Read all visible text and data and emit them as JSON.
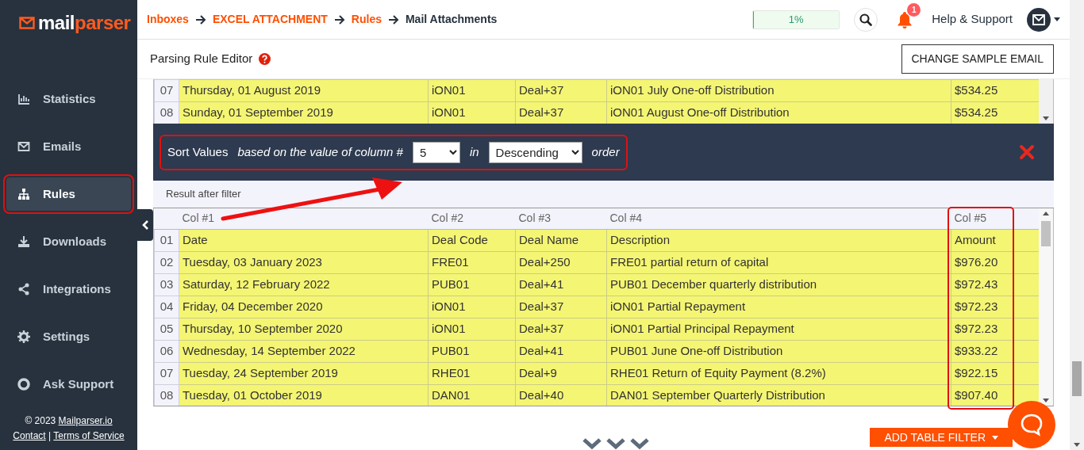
{
  "logo": {
    "text": "mail",
    "accent": "parser"
  },
  "sidebar": {
    "items": [
      {
        "label": "Statistics",
        "selected": false
      },
      {
        "label": "Emails",
        "selected": false
      },
      {
        "label": "Rules",
        "selected": true
      },
      {
        "label": "Downloads",
        "selected": false
      },
      {
        "label": "Integrations",
        "selected": false
      },
      {
        "label": "Settings",
        "selected": false
      },
      {
        "label": "Ask Support",
        "selected": false
      }
    ],
    "footer": {
      "copyright": "© 2023",
      "site_link": "Mailparser.io",
      "links": [
        "Contact",
        "Terms of Service"
      ],
      "separator": "|"
    }
  },
  "breadcrumb": [
    {
      "label": "Inboxes",
      "current": false
    },
    {
      "label": "EXCEL ATTACHMENT",
      "current": false
    },
    {
      "label": "Rules",
      "current": false
    },
    {
      "label": "Mail Attachments",
      "current": true
    }
  ],
  "usage": {
    "label": "1%",
    "level": 0.01
  },
  "notifications": {
    "count": "1"
  },
  "help_link": "Help & Support",
  "editor": {
    "title": "Parsing Rule Editor",
    "change_button": "CHANGE SAMPLE EMAIL"
  },
  "source_table": {
    "rows": [
      {
        "number": "07",
        "cells": [
          "Thursday, 01 August 2019",
          "iON01",
          "Deal+37",
          "iON01 July One-off Distribution",
          "$534.25"
        ]
      },
      {
        "number": "08",
        "cells": [
          "Sunday, 01 September 2019",
          "iON01",
          "Deal+37",
          "iON01 August One-off Distribution",
          "$534.25"
        ]
      }
    ]
  },
  "filter": {
    "title": "Sort Values",
    "text_1": "based on the value of column #",
    "column": "5",
    "text_2": "in",
    "order": "Descending",
    "text_3": "order"
  },
  "result_label": "Result after filter",
  "result_table": {
    "columns": [
      "Col #1",
      "Col #2",
      "Col #3",
      "Col #4",
      "Col #5"
    ],
    "rows": [
      {
        "number": "01",
        "cells": [
          "Date",
          "Deal Code",
          "Deal Name",
          "Description",
          "Amount"
        ]
      },
      {
        "number": "02",
        "cells": [
          "Tuesday, 03 January 2023",
          "FRE01",
          "Deal+250",
          "FRE01 partial return of capital",
          "$976.20"
        ]
      },
      {
        "number": "03",
        "cells": [
          "Saturday, 12 February 2022",
          "PUB01",
          "Deal+41",
          "PUB01 December quarterly distribution",
          "$972.43"
        ]
      },
      {
        "number": "04",
        "cells": [
          "Friday, 04 December 2020",
          "iON01",
          "Deal+37",
          "iON01 Partial Repayment",
          "$972.23"
        ]
      },
      {
        "number": "05",
        "cells": [
          "Thursday, 10 September 2020",
          "iON01",
          "Deal+37",
          "iON01 Partial Principal Repayment",
          "$972.23"
        ]
      },
      {
        "number": "06",
        "cells": [
          "Wednesday, 14 September 2022",
          "PUB01",
          "Deal+41",
          "PUB01 June One-off Distribution",
          "$933.22"
        ]
      },
      {
        "number": "07",
        "cells": [
          "Tuesday, 24 September 2019",
          "RHE01",
          "Deal+9",
          "RHE01 Return of Equity Payment (8.2%)",
          "$922.15"
        ]
      },
      {
        "number": "08",
        "cells": [
          "Tuesday, 01 October 2019",
          "DAN01",
          "Deal+40",
          "DAN01 September Quarterly Distribution",
          "$907.40"
        ]
      }
    ]
  },
  "add_filter_button": "ADD TABLE FILTER"
}
